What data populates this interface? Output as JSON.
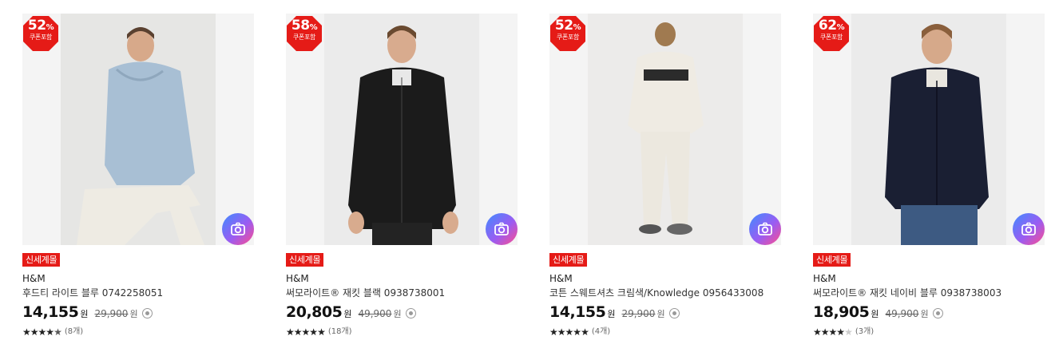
{
  "products": [
    {
      "discount": "52",
      "discount_unit": "%",
      "coupon_label": "쿠폰포함",
      "tag": "신세계몰",
      "brand": "H&M",
      "name": "후드티 라이트 블루 0742258051",
      "price": "14,155",
      "price_unit": "원",
      "original_price": "29,900",
      "original_unit": "원",
      "rating": 4.5,
      "review_count": "(8개)",
      "photo_colors": {
        "bg": "#e6e6e4",
        "top": "#a8bfd4",
        "bottom": "#eeebe3",
        "skin": "#d7a98a",
        "hair": "#5a4130"
      },
      "image_description": "Model in light blue hoodie and cream pants"
    },
    {
      "discount": "58",
      "discount_unit": "%",
      "coupon_label": "쿠폰포함",
      "tag": "신세계몰",
      "brand": "H&M",
      "name": "써모라이트® 재킷 블랙 0938738001",
      "price": "20,805",
      "price_unit": "원",
      "original_price": "49,900",
      "original_unit": "원",
      "rating": 5,
      "review_count": "(18개)",
      "photo_colors": {
        "bg": "#ebebeb",
        "top": "#1b1b1b",
        "bottom": "#232323",
        "skin": "#d8ab8e",
        "hair": "#6a4a30"
      },
      "image_description": "Model in black fleece zip jacket"
    },
    {
      "discount": "52",
      "discount_unit": "%",
      "coupon_label": "쿠폰포함",
      "tag": "신세계몰",
      "brand": "H&M",
      "name": "코튼 스웨트셔츠 크림색/Knowledge 0956433008",
      "price": "14,155",
      "price_unit": "원",
      "original_price": "29,900",
      "original_unit": "원",
      "rating": 5,
      "review_count": "(4개)",
      "photo_colors": {
        "bg": "#ecebea",
        "top": "#efebe3",
        "bottom": "#ece8df",
        "skin": "#d7ad8f",
        "hair": "#a07a50"
      },
      "image_description": "Model in cream sweatshirt and joggers, back view"
    },
    {
      "discount": "62",
      "discount_unit": "%",
      "coupon_label": "쿠폰포함",
      "tag": "신세계몰",
      "brand": "H&M",
      "name": "써모라이트® 재킷 네이비 블루 0938738003",
      "price": "18,905",
      "price_unit": "원",
      "original_price": "49,900",
      "original_unit": "원",
      "rating": 4,
      "review_count": "(3개)",
      "photo_colors": {
        "bg": "#ebebeb",
        "top": "#1a1f33",
        "bottom": "#3d5a82",
        "skin": "#d6a98a",
        "hair": "#8a5f3c"
      },
      "image_description": "Model in navy fleece zip jacket and jeans"
    }
  ],
  "colors": {
    "badge": "#e51b17",
    "tag": "#e51b17",
    "camera_gradient": [
      "#3f8cff",
      "#9a5cf2",
      "#ff4d8d"
    ]
  }
}
